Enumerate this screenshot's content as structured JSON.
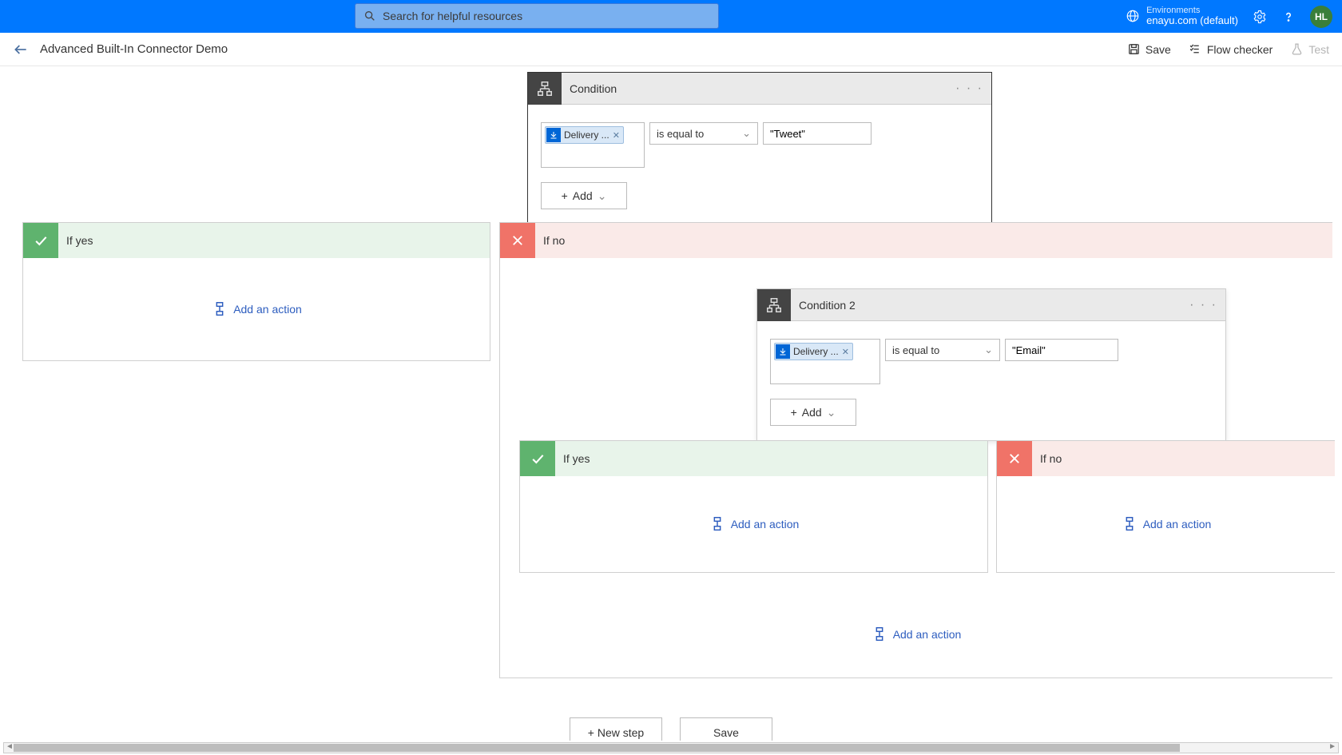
{
  "topbar": {
    "search_placeholder": "Search for helpful resources",
    "env_label": "Environments",
    "env_name": "enayu.com (default)",
    "user_initials": "HL"
  },
  "toolbar": {
    "flow_title": "Advanced Built-In Connector Demo",
    "save_label": "Save",
    "flow_checker_label": "Flow checker",
    "test_label": "Test"
  },
  "condition1": {
    "title": "Condition",
    "token_label": "Delivery ...",
    "operator": "is equal to",
    "value": "\"Tweet\"",
    "add_label": "Add"
  },
  "condition2": {
    "title": "Condition 2",
    "token_label": "Delivery ...",
    "operator": "is equal to",
    "value": "\"Email\"",
    "add_label": "Add"
  },
  "branches": {
    "if_yes": "If yes",
    "if_no": "If no",
    "add_action": "Add an action"
  },
  "footer": {
    "new_step": "+ New step",
    "save": "Save"
  }
}
